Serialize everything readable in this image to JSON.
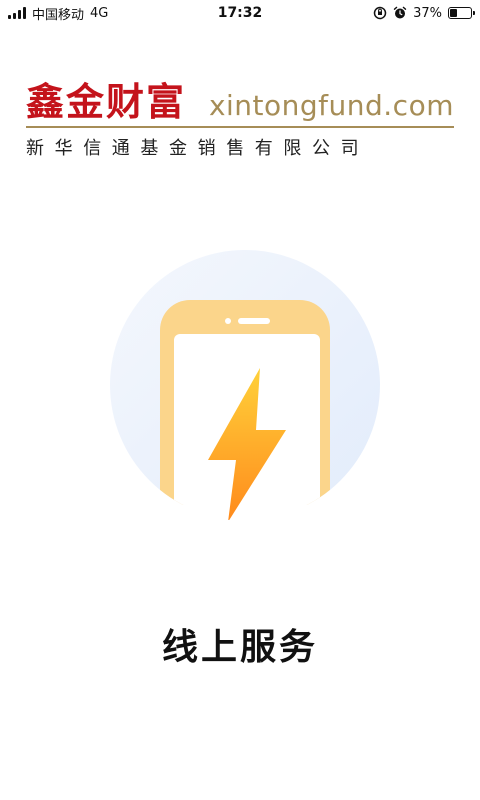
{
  "status_bar": {
    "carrier": "中国移动",
    "network": "4G",
    "time": "17:32",
    "battery_percent_text": "37%",
    "battery_level": 0.37,
    "icons": [
      "signal-icon",
      "orientation-lock-icon",
      "alarm-icon",
      "battery-icon"
    ]
  },
  "header": {
    "logo_cn": "鑫金财富",
    "logo_domain": "xintongfund.com",
    "company_name": "新华信通基金销售有限公司"
  },
  "main": {
    "illustration_icon": "phone-lightning-icon",
    "title": "线上服务"
  },
  "colors": {
    "brand_red": "#c4131b",
    "brand_gold": "#a68d57",
    "phone_body": "#fbd58b",
    "bolt_top": "#ffd13a",
    "bolt_bottom": "#ff8a1c",
    "circle_bg": "#eaf1fc"
  }
}
